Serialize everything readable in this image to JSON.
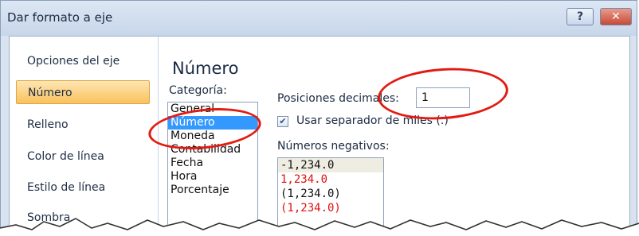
{
  "window": {
    "title": "Dar formato a eje",
    "help_label": "?",
    "close_label": "✕"
  },
  "sidebar": {
    "items": [
      {
        "label": "Opciones del eje"
      },
      {
        "label": "Número"
      },
      {
        "label": "Relleno"
      },
      {
        "label": "Color de línea"
      },
      {
        "label": "Estilo de línea"
      },
      {
        "label": "Sombra"
      }
    ]
  },
  "main": {
    "heading": "Número",
    "category_label": "Categoría:",
    "categories": [
      "General",
      "Número",
      "Moneda",
      "Contabilidad",
      "Fecha",
      "Hora",
      "Porcentaje"
    ],
    "decimal_label": "Posiciones decimales:",
    "decimal_value": "1",
    "thousands_label": "Usar separador de miles (.)",
    "negative_label": "Números negativos:",
    "negatives": [
      {
        "text": "-1,234.0",
        "color": "black"
      },
      {
        "text": "1,234.0",
        "color": "red"
      },
      {
        "text": "(1,234.0)",
        "color": "black"
      },
      {
        "text": "(1,234.0)",
        "color": "red"
      }
    ]
  },
  "colors": {
    "accent_red": "#e21b12",
    "selection_blue": "#3399ff",
    "nav_active": "#f9c25d"
  }
}
